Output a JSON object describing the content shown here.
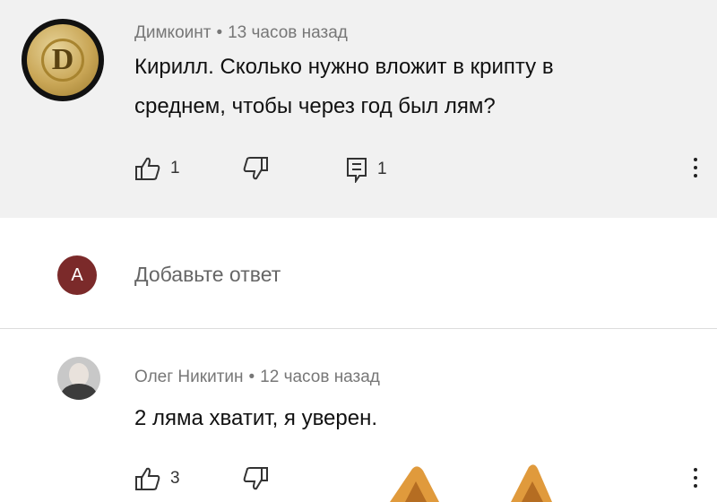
{
  "comment": {
    "avatar_letter": "D",
    "author": "Димкоинт",
    "time": "13 часов назад",
    "text_line1": "Кирилл. Сколько нужно вложит в крипту в",
    "text_line2": "среднем, чтобы через год был лям?",
    "likes": "1",
    "replies": "1"
  },
  "reply_box": {
    "avatar_letter": "A",
    "placeholder": "Добавьте ответ"
  },
  "reply": {
    "author": "Олег Никитин",
    "time": "12 часов назад",
    "text": "2 ляма хватит, я уверен.",
    "likes": "3"
  },
  "separator": "•",
  "icons": {
    "like": "thumbs-up-icon",
    "dislike": "thumbs-down-icon",
    "reply": "reply-comment-icon",
    "menu": "more-vertical-icon"
  },
  "colors": {
    "comment_bg": "#f1f1f1",
    "avatar_a_bg": "#7b2a2a",
    "cat_orange": "#e09a3c"
  }
}
